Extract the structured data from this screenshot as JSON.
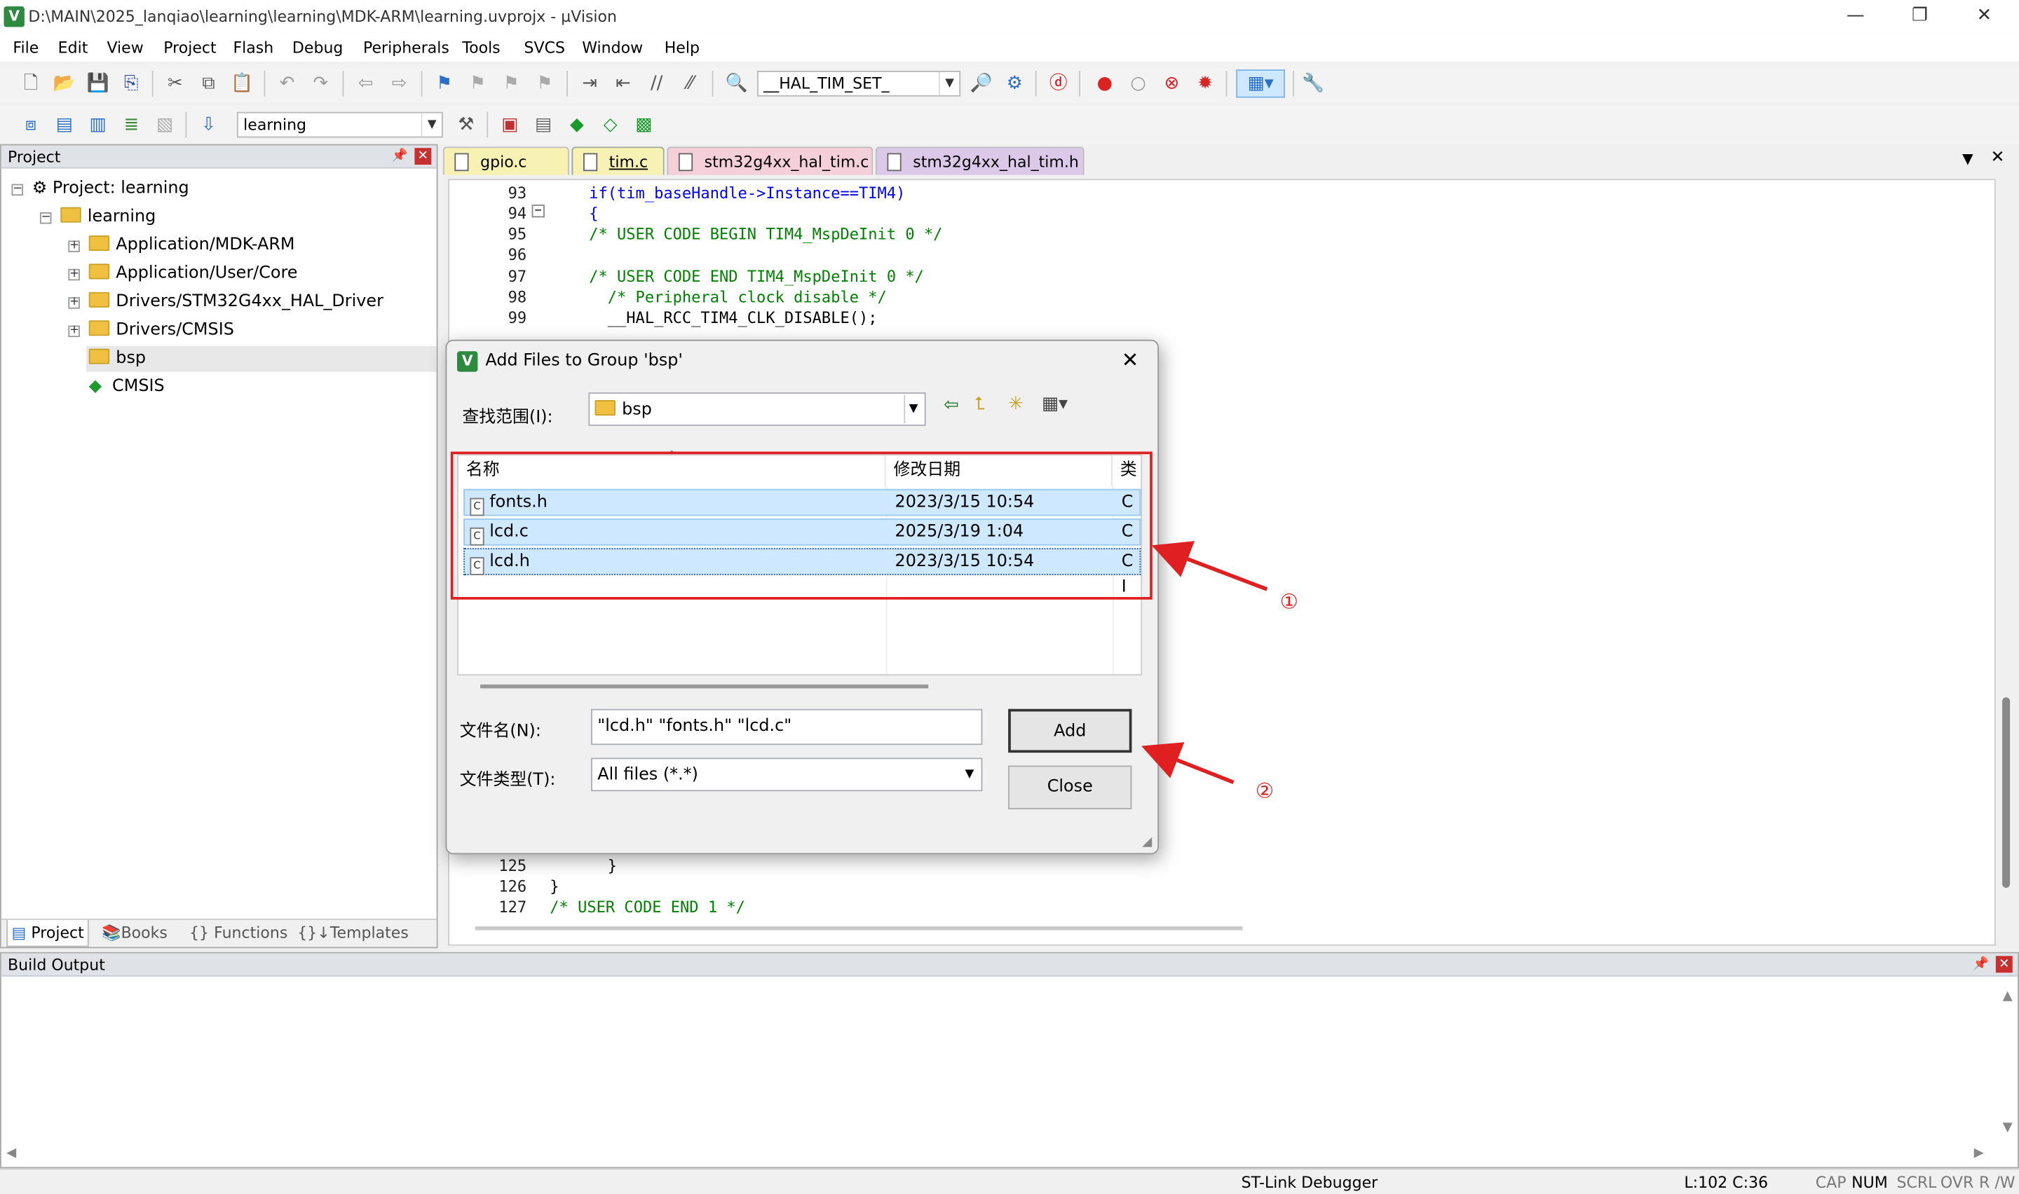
{
  "window": {
    "title": "D:\\MAIN\\2025_lanqiao\\learning\\learning\\MDK-ARM\\learning.uvprojx - µVision",
    "minimize": "—",
    "restore": "❐",
    "close": "✕"
  },
  "menu": [
    "File",
    "Edit",
    "View",
    "Project",
    "Flash",
    "Debug",
    "Peripherals",
    "Tools",
    "SVCS",
    "Window",
    "Help"
  ],
  "toolbar": {
    "find_combo": "__HAL_TIM_SET_",
    "target_combo": "learning"
  },
  "project": {
    "title": "Project",
    "tree": [
      {
        "label": "Project: learning",
        "level": 0
      },
      {
        "label": "learning",
        "level": 1
      },
      {
        "label": "Application/MDK-ARM",
        "level": 2
      },
      {
        "label": "Application/User/Core",
        "level": 2
      },
      {
        "label": "Drivers/STM32G4xx_HAL_Driver",
        "level": 2
      },
      {
        "label": "Drivers/CMSIS",
        "level": 2
      },
      {
        "label": "bsp",
        "level": 2
      },
      {
        "label": "CMSIS",
        "level": 2
      }
    ],
    "tabs": [
      "Project",
      "Books",
      "Functions",
      "Templates"
    ]
  },
  "editor": {
    "tabs": [
      "gpio.c",
      "tim.c",
      "stm32g4xx_hal_tim.c",
      "stm32g4xx_hal_tim.h"
    ],
    "lines": [
      {
        "n": "93",
        "text": "  if(tim_baseHandle->Instance==TIM4)"
      },
      {
        "n": "94",
        "text": "  {"
      },
      {
        "n": "95",
        "text": "  /* USER CODE BEGIN TIM4_MspDeInit 0 */"
      },
      {
        "n": "96",
        "text": ""
      },
      {
        "n": "97",
        "text": "  /* USER CODE END TIM4_MspDeInit 0 */"
      },
      {
        "n": "98",
        "text": "    /* Peripheral clock disable */"
      },
      {
        "n": "99",
        "text": "    __HAL_RCC_TIM4_CLK_DISABLE();"
      },
      {
        "n": "125",
        "text": "    }"
      },
      {
        "n": "126",
        "text": "}"
      },
      {
        "n": "127",
        "text": "/* USER CODE END 1 */"
      }
    ]
  },
  "build": {
    "title": "Build Output"
  },
  "status": {
    "debugger": "ST-Link Debugger",
    "position": "L:102 C:36",
    "cap": "CAP",
    "num": "NUM",
    "scrl": "SCRL",
    "ovr": "OVR",
    "rw": "R /W"
  },
  "dialog": {
    "title": "Add Files to Group 'bsp'",
    "lookin_label": "查找范围(I):",
    "lookin_value": "bsp",
    "columns": [
      "名称",
      "修改日期",
      "类"
    ],
    "files": [
      {
        "name": "fonts.h",
        "date": "2023/3/15 10:54",
        "type": "C I"
      },
      {
        "name": "lcd.c",
        "date": "2025/3/19 1:04",
        "type": "C i"
      },
      {
        "name": "lcd.h",
        "date": "2023/3/15 10:54",
        "type": "C I"
      }
    ],
    "filename_label": "文件名(N):",
    "filename_value": "\"lcd.h\" \"fonts.h\" \"lcd.c\"",
    "filetype_label": "文件类型(T):",
    "filetype_value": "All files (*.*)",
    "add": "Add",
    "close": "Close"
  },
  "annotations": {
    "one": "①",
    "two": "②"
  },
  "colors": {
    "annotation": "#e02020",
    "selection": "#cde8ff",
    "keyword": "#0000ff",
    "comment": "#008000"
  }
}
